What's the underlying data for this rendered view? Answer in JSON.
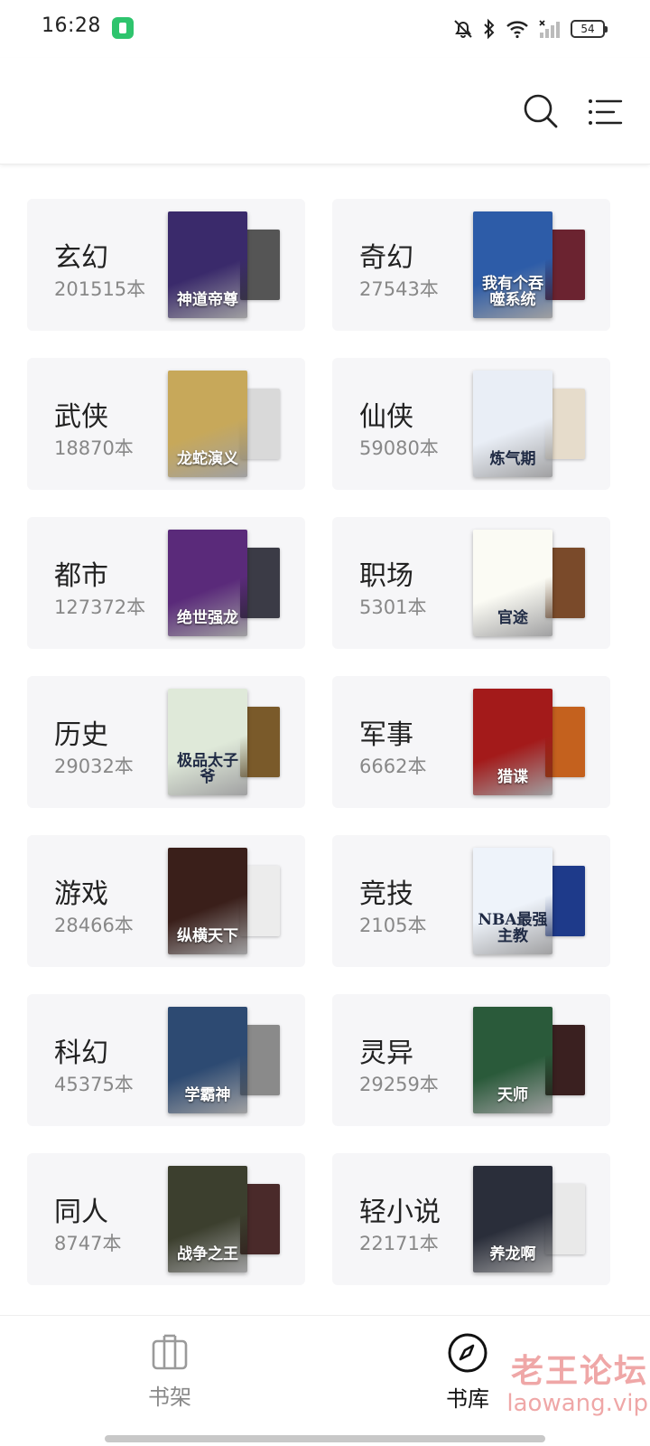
{
  "status_bar": {
    "time": "16:28",
    "battery": "54",
    "icons": [
      "app-badge-icon",
      "mute-bell-icon",
      "bluetooth-icon",
      "wifi-icon",
      "no-signal-icon",
      "battery-icon"
    ]
  },
  "header": {
    "icons": [
      "search-icon",
      "filter-menu-icon"
    ]
  },
  "categories": [
    {
      "name": "玄幻",
      "count": "201515本",
      "cover_text": "神道帝尊",
      "front_color": "#3a2a6b",
      "back_color": "#555"
    },
    {
      "name": "奇幻",
      "count": "27543本",
      "cover_text": "我有个吞噬系统",
      "front_color": "#2d5ca8",
      "back_color": "#6b2330"
    },
    {
      "name": "武侠",
      "count": "18870本",
      "cover_text": "龙蛇演义",
      "front_color": "#c7a85a",
      "back_color": "#d9d9d9"
    },
    {
      "name": "仙侠",
      "count": "59080本",
      "cover_text": "炼气期",
      "front_color": "#e9eef6",
      "back_color": "#e6dccb"
    },
    {
      "name": "都市",
      "count": "127372本",
      "cover_text": "绝世强龙",
      "front_color": "#5a2a7a",
      "back_color": "#3b3b46"
    },
    {
      "name": "职场",
      "count": "5301本",
      "cover_text": "官途",
      "front_color": "#fbfbf4",
      "back_color": "#7a4a2a"
    },
    {
      "name": "历史",
      "count": "29032本",
      "cover_text": "极品太子爷",
      "front_color": "#dfe9d9",
      "back_color": "#7a5a2a"
    },
    {
      "name": "军事",
      "count": "6662本",
      "cover_text": "猎谍",
      "front_color": "#a31a1a",
      "back_color": "#c4611e"
    },
    {
      "name": "游戏",
      "count": "28466本",
      "cover_text": "纵横天下",
      "front_color": "#3a1f1a",
      "back_color": "#ececec"
    },
    {
      "name": "竞技",
      "count": "2105本",
      "cover_text": "NBA最强主教",
      "front_color": "#eef3fa",
      "back_color": "#1e3a8a"
    },
    {
      "name": "科幻",
      "count": "45375本",
      "cover_text": "学霸神",
      "front_color": "#2d4a72",
      "back_color": "#8a8a8a"
    },
    {
      "name": "灵异",
      "count": "29259本",
      "cover_text": "天师",
      "front_color": "#2a5a3a",
      "back_color": "#3a2020"
    },
    {
      "name": "同人",
      "count": "8747本",
      "cover_text": "战争之王",
      "front_color": "#3c3f2e",
      "back_color": "#4a2a2a"
    },
    {
      "name": "轻小说",
      "count": "22171本",
      "cover_text": "养龙啊",
      "front_color": "#2a2e3a",
      "back_color": "#e9e9e9"
    }
  ],
  "bottom_nav": {
    "shelf_label": "书架",
    "library_label": "书库",
    "active": "书库"
  },
  "watermark": {
    "text": "老王论坛",
    "url": "laowang.vip"
  }
}
